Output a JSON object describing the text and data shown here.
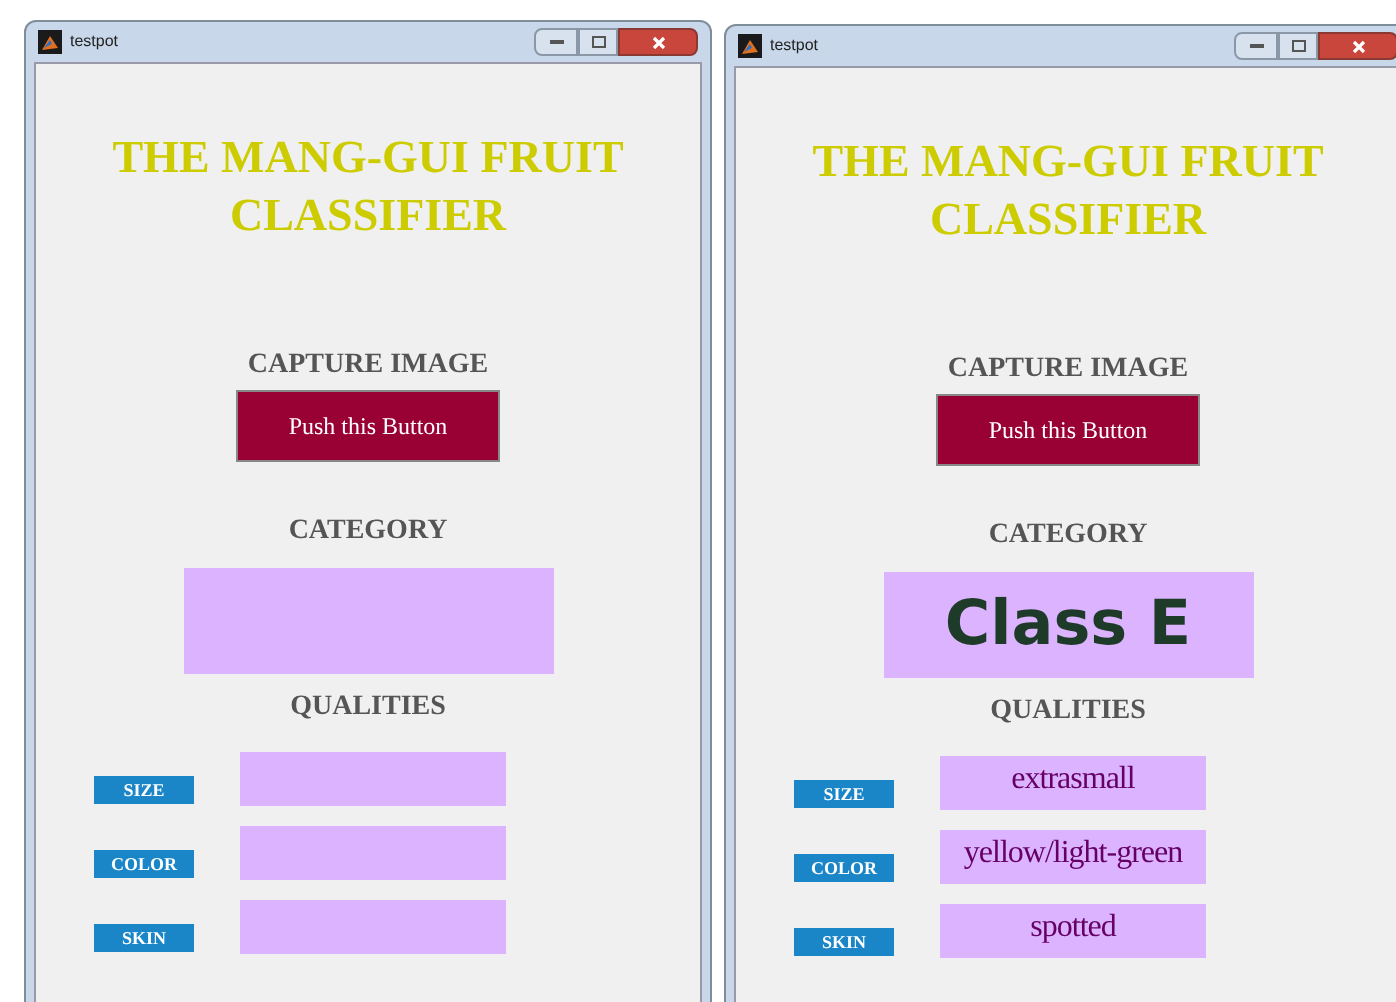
{
  "windows": [
    {
      "title": "testpot",
      "heading": "THE MANG-GUI FRUIT CLASSIFIER",
      "capture_label": "CAPTURE IMAGE",
      "capture_button": "Push this Button",
      "category_label": "CATEGORY",
      "qualities_label": "QUALITIES",
      "qualities": [
        {
          "label": "SIZE"
        },
        {
          "label": "COLOR"
        },
        {
          "label": "SKIN"
        }
      ]
    },
    {
      "title": "testpot",
      "heading": "THE MANG-GUI FRUIT CLASSIFIER",
      "capture_label": "CAPTURE IMAGE",
      "capture_button": "Push this Button",
      "category_label": "CATEGORY",
      "category": "Class E",
      "qualities_label": "QUALITIES",
      "qualities": [
        {
          "label": "SIZE",
          "value": "extrasmall"
        },
        {
          "label": "COLOR",
          "value": "yellow/light-green"
        },
        {
          "label": "SKIN",
          "value": "spotted"
        }
      ]
    }
  ]
}
